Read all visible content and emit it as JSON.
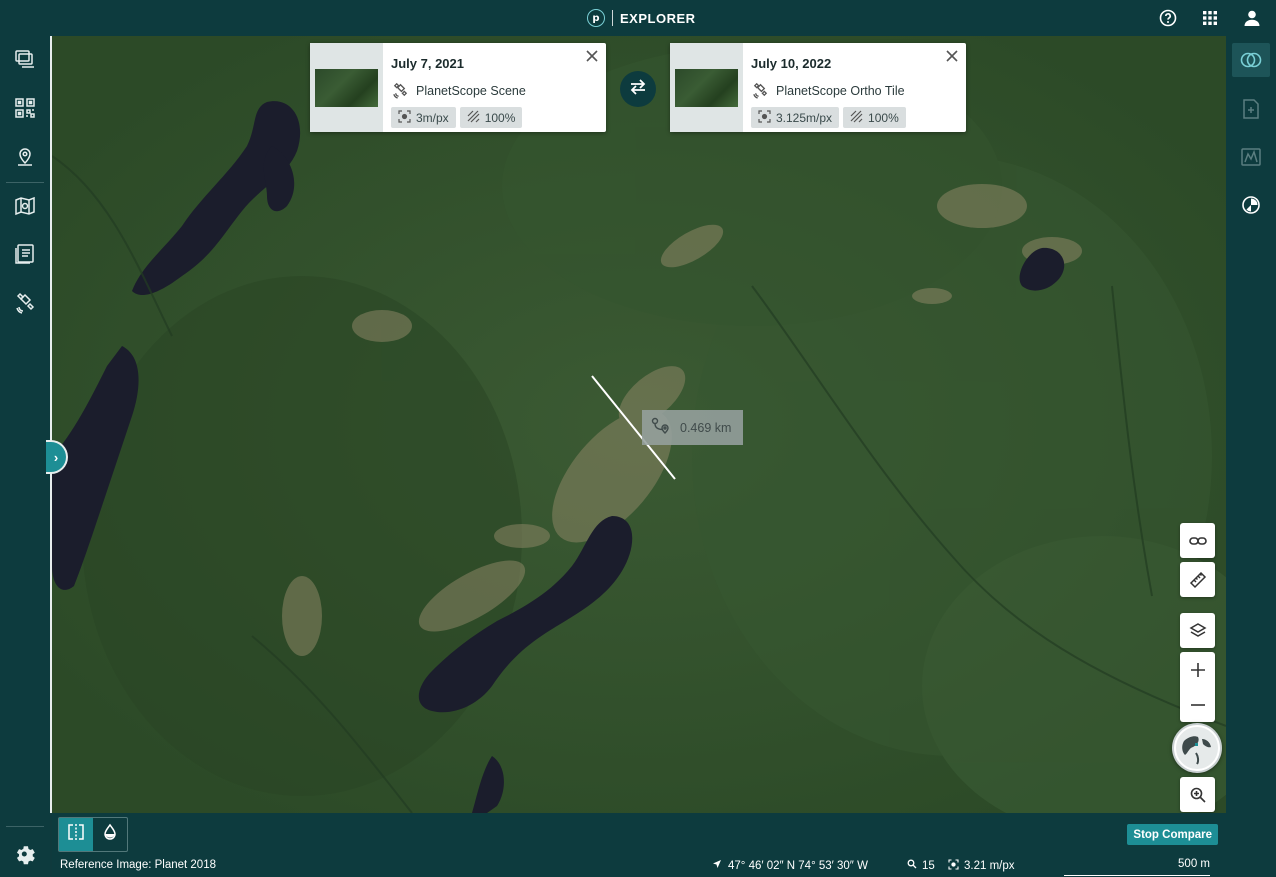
{
  "app": {
    "name": "EXPLORER",
    "logo_letter": "p"
  },
  "header": {
    "icons": [
      "help-icon",
      "apps-grid-icon",
      "account-icon"
    ]
  },
  "left_rail": {
    "items": [
      "layers-icon",
      "qr-grid-icon",
      "location-pin-icon",
      "map-search-icon",
      "catalog-icon",
      "satellite-icon"
    ],
    "settings": "settings-icon"
  },
  "right_rail": {
    "items": [
      "compare-icon",
      "add-image-icon",
      "terrain-icon",
      "timelapse-icon"
    ]
  },
  "compare": {
    "left": {
      "date": "July 7, 2021",
      "source": "PlanetScope Scene",
      "resolution": "3m/px",
      "coverage": "100%"
    },
    "right": {
      "date": "July 10, 2022",
      "source": "PlanetScope Ortho Tile",
      "resolution": "3.125m/px",
      "coverage": "100%"
    }
  },
  "measurement": {
    "distance": "0.469 km"
  },
  "map_controls": [
    "link-icon",
    "ruler-icon",
    "layers-icon",
    "zoom-in-icon",
    "zoom-out-icon",
    "globe-icon",
    "zoom-area-icon"
  ],
  "bottom": {
    "stop_compare": "Stop Compare"
  },
  "status": {
    "reference": "Reference Image: Planet 2018",
    "coordinates": "47° 46′ 02″ N 74° 53′ 30″ W",
    "zoom": "15",
    "resolution": "3.21 m/px",
    "scale": "500 m"
  },
  "colors": {
    "header": "#0d3b3e",
    "accent": "#1d8e95"
  }
}
